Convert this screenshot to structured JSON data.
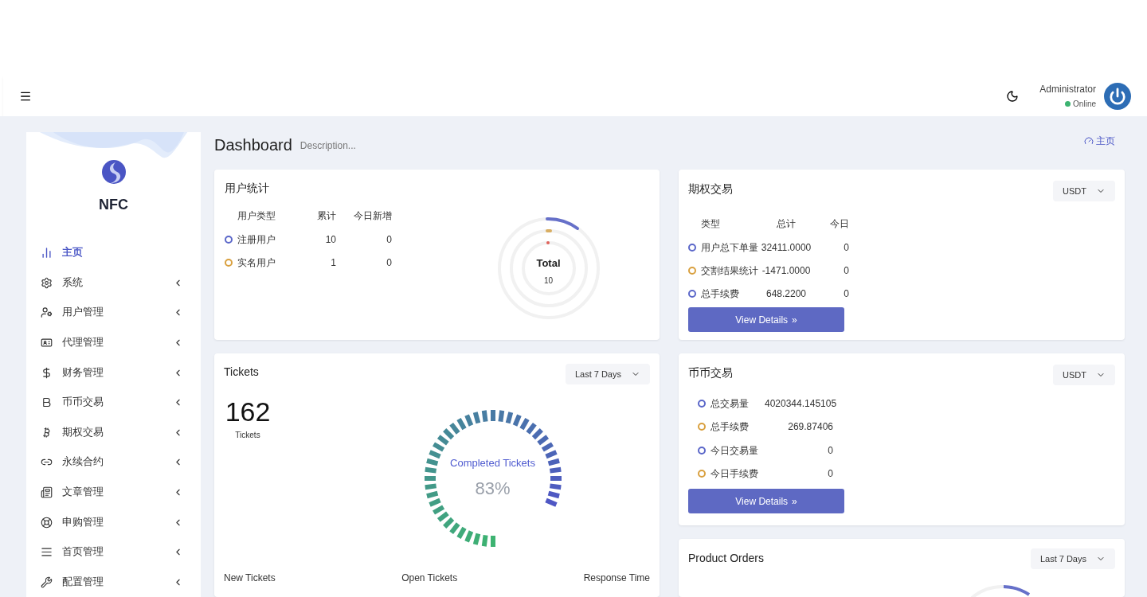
{
  "header": {
    "user_name": "Administrator",
    "status": "Online",
    "online": true
  },
  "sidebar": {
    "brand": "NFC",
    "items": [
      {
        "label": "主页",
        "selected": true,
        "has_submenu": false
      },
      {
        "label": "系统",
        "selected": false,
        "has_submenu": true
      },
      {
        "label": "用户管理",
        "selected": false,
        "has_submenu": true
      },
      {
        "label": "代理管理",
        "selected": false,
        "has_submenu": true
      },
      {
        "label": "财务管理",
        "selected": false,
        "has_submenu": true
      },
      {
        "label": "币币交易",
        "selected": false,
        "has_submenu": true
      },
      {
        "label": "期权交易",
        "selected": false,
        "has_submenu": true
      },
      {
        "label": "永续合约",
        "selected": false,
        "has_submenu": true
      },
      {
        "label": "文章管理",
        "selected": false,
        "has_submenu": true
      },
      {
        "label": "申购管理",
        "selected": false,
        "has_submenu": true
      },
      {
        "label": "首页管理",
        "selected": false,
        "has_submenu": true
      },
      {
        "label": "配置管理",
        "selected": false,
        "has_submenu": true
      }
    ]
  },
  "page": {
    "title": "Dashboard",
    "description": "Description...",
    "breadcrumb": "主页"
  },
  "user_stats": {
    "title": "用户统计",
    "columns": [
      "用户类型",
      "累计",
      "今日新增"
    ],
    "rows": [
      {
        "label": "注册用户",
        "total": "10",
        "today": "0",
        "color": "#5b67c9"
      },
      {
        "label": "实名用户",
        "total": "1",
        "today": "0",
        "color": "#d9a03f"
      }
    ],
    "center_label": "Total",
    "center_value": "10"
  },
  "options_trading": {
    "title": "期权交易",
    "currency": "USDT",
    "columns": [
      "类型",
      "总计",
      "今日"
    ],
    "rows": [
      {
        "label": "用户总下单量",
        "total": "32411.0000",
        "today": "0",
        "color": "#5b67c9"
      },
      {
        "label": "交割结果统计",
        "total": "-1471.0000",
        "today": "0",
        "color": "#d9a03f"
      },
      {
        "label": "总手续费",
        "total": "648.2200",
        "today": "0",
        "color": "#5b67c9"
      }
    ],
    "button": "View Details",
    "button_icon": "»"
  },
  "spot_trading": {
    "title": "币币交易",
    "currency": "USDT",
    "rows": [
      {
        "label": "总交易量",
        "value": "4020344.145105",
        "color": "#5b67c9"
      },
      {
        "label": "总手续费",
        "value": "269.87406",
        "color": "#d9a03f"
      },
      {
        "label": "今日交易量",
        "value": "0",
        "color": "#5b67c9"
      },
      {
        "label": "今日手续费",
        "value": "0",
        "color": "#d9a03f"
      }
    ],
    "button": "View Details",
    "button_icon": "»"
  },
  "tickets": {
    "title": "Tickets",
    "range": "Last 7 Days",
    "count": "162",
    "count_label": "Tickets",
    "gauge_title": "Completed Tickets",
    "gauge_value": "83%",
    "footer": [
      "New Tickets",
      "Open Tickets",
      "Response Time"
    ]
  },
  "product_orders": {
    "title": "Product Orders",
    "range": "Last 7 Days"
  }
}
